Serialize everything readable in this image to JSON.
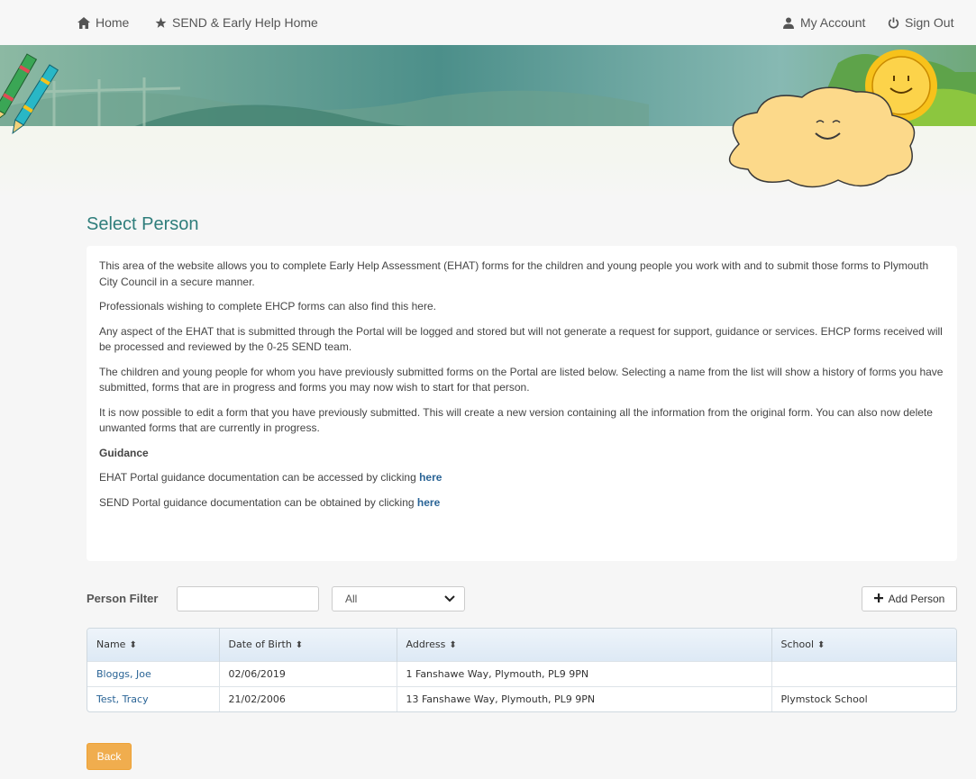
{
  "nav": {
    "home": "Home",
    "send_home": "SEND & Early Help Home",
    "my_account": "My Account",
    "sign_out": "Sign Out"
  },
  "page": {
    "title": "Select Person"
  },
  "intro": {
    "p1": "This area of the website allows you to complete Early Help Assessment (EHAT) forms for the children and young people you work with and to submit those forms to Plymouth City Council in a secure manner.",
    "p2": "Professionals wishing to complete EHCP forms can also find this here.",
    "p3": "Any aspect of the EHAT that is submitted through the Portal will be logged and stored but will not generate a request for support, guidance or services. EHCP forms received will be processed and reviewed by the 0-25 SEND team.",
    "p4": "The children and young people for whom you have previously submitted forms on the Portal are listed below. Selecting a name from the list will show a history of forms you have submitted, forms that are in progress and forms you may now wish to start for that person.",
    "p5": "It is now possible to edit a form that you have previously submitted. This will create a new version containing all the information from the original form. You can also now delete unwanted forms that are currently in progress.",
    "guidance_heading": "Guidance",
    "ehat_text": "EHAT Portal guidance documentation can be accessed by clicking ",
    "ehat_link": "here",
    "send_text": "SEND Portal guidance documentation can be obtained by clicking ",
    "send_link": "here"
  },
  "filter": {
    "label": "Person Filter",
    "value": "",
    "placeholder": "",
    "select_value": "All",
    "add_button": "Add Person"
  },
  "table": {
    "headers": {
      "name": "Name",
      "dob": "Date of Birth",
      "address": "Address",
      "school": "School"
    },
    "rows": [
      {
        "name": "Bloggs, Joe",
        "dob": "02/06/2019",
        "address": "1 Fanshawe Way, Plymouth, PL9 9PN",
        "school": ""
      },
      {
        "name": "Test, Tracy",
        "dob": "21/02/2006",
        "address": "13 Fanshawe Way, Plymouth, PL9 9PN",
        "school": "Plymstock School"
      }
    ]
  },
  "back_button": "Back",
  "colors": {
    "title_teal": "#2e7d7b",
    "link_blue": "#2a6496",
    "back_orange": "#f0ad4e",
    "banner_teal": "#4c8f8a",
    "cloud_yellow": "#fcd98a",
    "sun_yellow": "#f7c21b"
  },
  "icons": {
    "home": "home-icon",
    "star": "star-icon",
    "user": "user-icon",
    "power": "power-icon",
    "plus": "plus-icon",
    "chevron": "chevron-down-icon",
    "sort": "sort-icon"
  }
}
